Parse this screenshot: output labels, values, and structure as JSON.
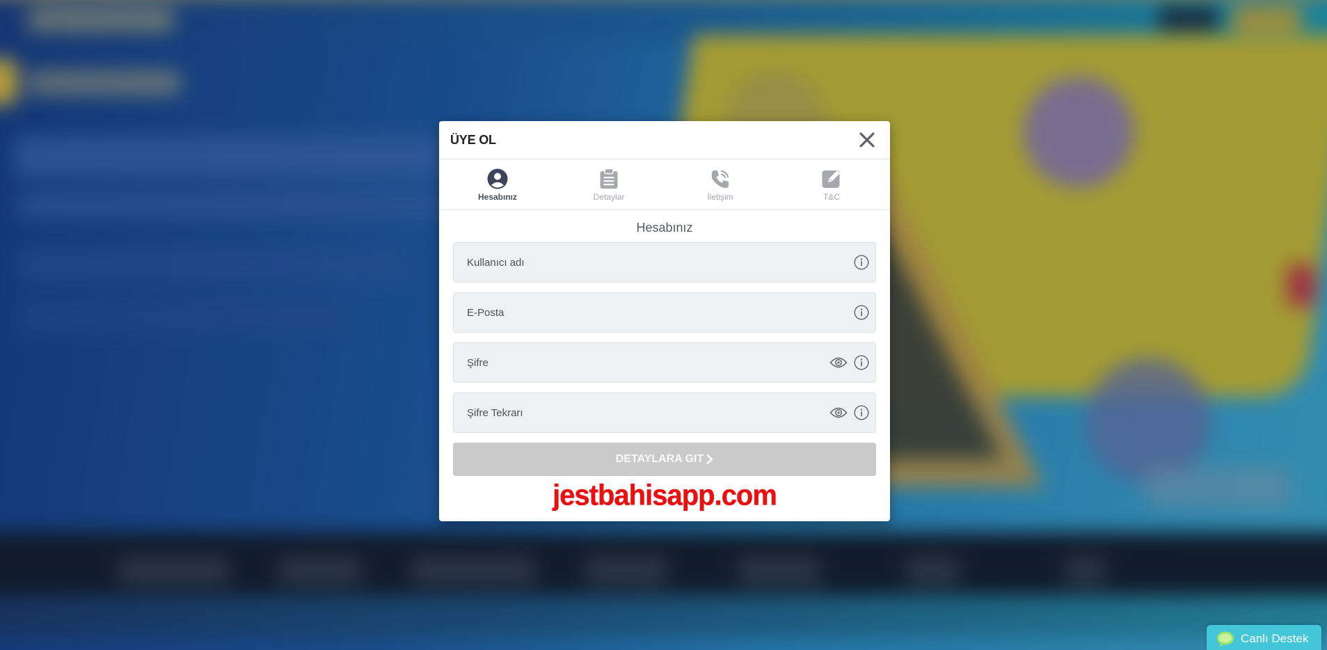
{
  "modal": {
    "title": "ÜYE OL",
    "steps": [
      {
        "label": "Hesabınız",
        "icon": "user-circle-icon",
        "active": true
      },
      {
        "label": "Detaylar",
        "icon": "clipboard-icon",
        "active": false
      },
      {
        "label": "İletişim",
        "icon": "phone-icon",
        "active": false
      },
      {
        "label": "T&C",
        "icon": "edit-icon",
        "active": false
      }
    ],
    "section_title": "Hesabınız",
    "fields": {
      "username": {
        "placeholder": "Kullanıcı adı",
        "value": ""
      },
      "email": {
        "placeholder": "E-Posta",
        "value": ""
      },
      "password": {
        "placeholder": "Şifre",
        "value": ""
      },
      "password_repeat": {
        "placeholder": "Şifre Tekrarı",
        "value": ""
      }
    },
    "submit_label": "DETAYLARA GIT",
    "watermark": "jestbahisapp.com"
  },
  "live_support": {
    "label": "Canlı Destek"
  },
  "colors": {
    "active_step": "#3d4458",
    "inactive_step": "#a5a8ad",
    "submit_disabled": "#cacaca",
    "live_support": "#43c6d8",
    "watermark": "#e81010"
  }
}
